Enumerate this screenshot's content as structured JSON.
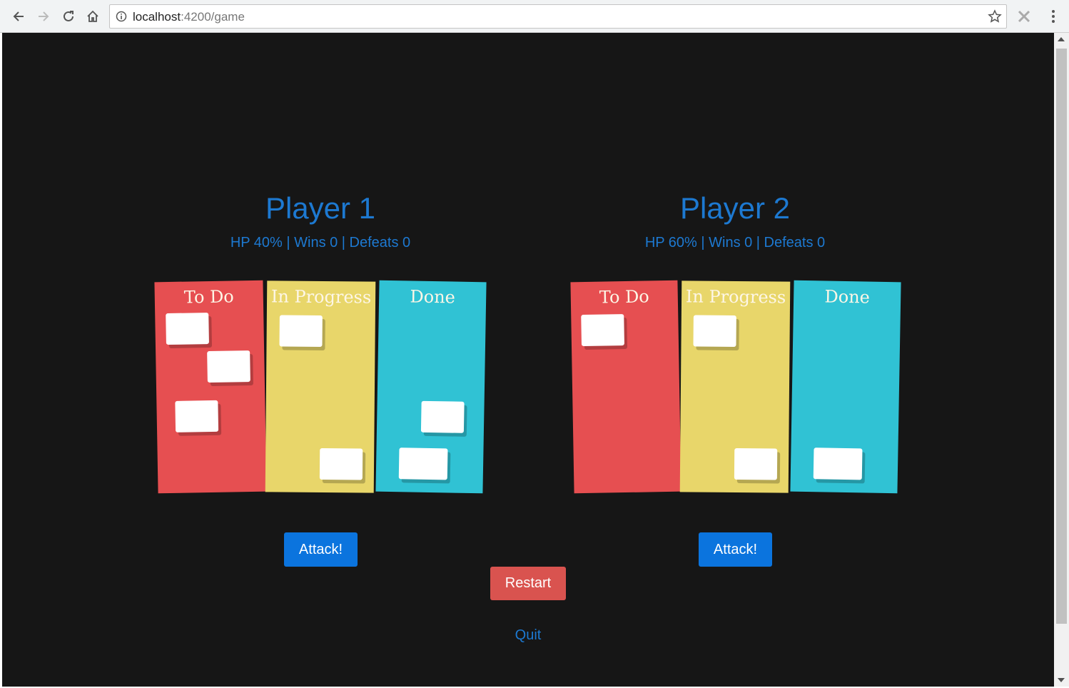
{
  "browser": {
    "url_host": "localhost",
    "url_rest": ":4200/game",
    "icons": [
      "back-icon",
      "forward-icon",
      "reload-icon",
      "home-icon",
      "info-icon",
      "star-icon",
      "extension-icon",
      "menu-icon"
    ]
  },
  "players": [
    {
      "name": "Player 1",
      "stats": "HP 40% | Wins 0 | Defeats 0",
      "hp_percent": 40,
      "attack_label": "Attack!",
      "columns": [
        {
          "title": "To Do",
          "color": "#e64f51",
          "cards": 3
        },
        {
          "title": "In Progress",
          "color": "#e8d66a",
          "cards": 2
        },
        {
          "title": "Done",
          "color": "#30c2d4",
          "cards": 2
        }
      ]
    },
    {
      "name": "Player 2",
      "stats": "HP 60% | Wins 0 | Defeats 0",
      "hp_percent": 60,
      "attack_label": "Attack!",
      "columns": [
        {
          "title": "To Do",
          "color": "#e64f51",
          "cards": 1
        },
        {
          "title": "In Progress",
          "color": "#e8d66a",
          "cards": 2
        },
        {
          "title": "Done",
          "color": "#30c2d4",
          "cards": 1
        }
      ]
    }
  ],
  "restart_label": "Restart",
  "quit_label": "Quit",
  "colors": {
    "background": "#161616",
    "accent_blue": "#1d79d1",
    "attack_button": "#0b74de",
    "restart_button": "#d9534f"
  }
}
